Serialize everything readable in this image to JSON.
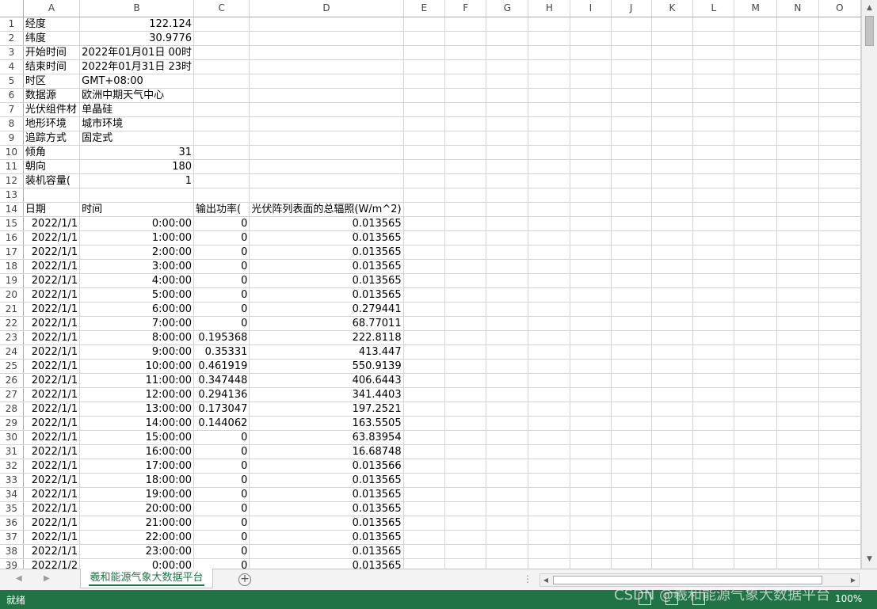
{
  "columns": [
    "A",
    "B",
    "C",
    "D",
    "E",
    "F",
    "G",
    "H",
    "I",
    "J",
    "K",
    "L",
    "M",
    "N",
    "O"
  ],
  "rows": [
    {
      "n": "1",
      "a": "经度",
      "b": "122.124",
      "c": "",
      "d": ""
    },
    {
      "n": "2",
      "a": "纬度",
      "b": "30.9776",
      "c": "",
      "d": ""
    },
    {
      "n": "3",
      "a": "开始时间",
      "b": "2022年01月01日 00时",
      "c": "",
      "d": ""
    },
    {
      "n": "4",
      "a": "结束时间",
      "b": "2022年01月31日 23时",
      "c": "",
      "d": ""
    },
    {
      "n": "5",
      "a": "时区",
      "b": "GMT+08:00",
      "c": "",
      "d": ""
    },
    {
      "n": "6",
      "a": "数据源",
      "b": "欧洲中期天气中心",
      "c": "",
      "d": ""
    },
    {
      "n": "7",
      "a": "光伏组件材",
      "b": "单晶硅",
      "c": "",
      "d": ""
    },
    {
      "n": "8",
      "a": "地形环境",
      "b": "城市环境",
      "c": "",
      "d": ""
    },
    {
      "n": "9",
      "a": "追踪方式",
      "b": "固定式",
      "c": "",
      "d": ""
    },
    {
      "n": "10",
      "a": "倾角",
      "b": "31",
      "c": "",
      "d": ""
    },
    {
      "n": "11",
      "a": "朝向",
      "b": "180",
      "c": "",
      "d": ""
    },
    {
      "n": "12",
      "a": "装机容量(",
      "b": "1",
      "c": "",
      "d": ""
    },
    {
      "n": "13",
      "a": "",
      "b": "",
      "c": "",
      "d": ""
    },
    {
      "n": "14",
      "a": "日期",
      "b": "时间",
      "c": "输出功率(",
      "d": "光伏阵列表面的总辐照(W/m^2)"
    },
    {
      "n": "15",
      "a": "2022/1/1",
      "b": "0:00:00",
      "c": "0",
      "d": "0.013565"
    },
    {
      "n": "16",
      "a": "2022/1/1",
      "b": "1:00:00",
      "c": "0",
      "d": "0.013565"
    },
    {
      "n": "17",
      "a": "2022/1/1",
      "b": "2:00:00",
      "c": "0",
      "d": "0.013565"
    },
    {
      "n": "18",
      "a": "2022/1/1",
      "b": "3:00:00",
      "c": "0",
      "d": "0.013565"
    },
    {
      "n": "19",
      "a": "2022/1/1",
      "b": "4:00:00",
      "c": "0",
      "d": "0.013565"
    },
    {
      "n": "20",
      "a": "2022/1/1",
      "b": "5:00:00",
      "c": "0",
      "d": "0.013565"
    },
    {
      "n": "21",
      "a": "2022/1/1",
      "b": "6:00:00",
      "c": "0",
      "d": "0.279441"
    },
    {
      "n": "22",
      "a": "2022/1/1",
      "b": "7:00:00",
      "c": "0",
      "d": "68.77011"
    },
    {
      "n": "23",
      "a": "2022/1/1",
      "b": "8:00:00",
      "c": "0.195368",
      "d": "222.8118"
    },
    {
      "n": "24",
      "a": "2022/1/1",
      "b": "9:00:00",
      "c": "0.35331",
      "d": "413.447"
    },
    {
      "n": "25",
      "a": "2022/1/1",
      "b": "10:00:00",
      "c": "0.461919",
      "d": "550.9139"
    },
    {
      "n": "26",
      "a": "2022/1/1",
      "b": "11:00:00",
      "c": "0.347448",
      "d": "406.6443"
    },
    {
      "n": "27",
      "a": "2022/1/1",
      "b": "12:00:00",
      "c": "0.294136",
      "d": "341.4403"
    },
    {
      "n": "28",
      "a": "2022/1/1",
      "b": "13:00:00",
      "c": "0.173047",
      "d": "197.2521"
    },
    {
      "n": "29",
      "a": "2022/1/1",
      "b": "14:00:00",
      "c": "0.144062",
      "d": "163.5505"
    },
    {
      "n": "30",
      "a": "2022/1/1",
      "b": "15:00:00",
      "c": "0",
      "d": "63.83954"
    },
    {
      "n": "31",
      "a": "2022/1/1",
      "b": "16:00:00",
      "c": "0",
      "d": "16.68748"
    },
    {
      "n": "32",
      "a": "2022/1/1",
      "b": "17:00:00",
      "c": "0",
      "d": "0.013566"
    },
    {
      "n": "33",
      "a": "2022/1/1",
      "b": "18:00:00",
      "c": "0",
      "d": "0.013565"
    },
    {
      "n": "34",
      "a": "2022/1/1",
      "b": "19:00:00",
      "c": "0",
      "d": "0.013565"
    },
    {
      "n": "35",
      "a": "2022/1/1",
      "b": "20:00:00",
      "c": "0",
      "d": "0.013565"
    },
    {
      "n": "36",
      "a": "2022/1/1",
      "b": "21:00:00",
      "c": "0",
      "d": "0.013565"
    },
    {
      "n": "37",
      "a": "2022/1/1",
      "b": "22:00:00",
      "c": "0",
      "d": "0.013565"
    },
    {
      "n": "38",
      "a": "2022/1/1",
      "b": "23:00:00",
      "c": "0",
      "d": "0.013565"
    },
    {
      "n": "39",
      "a": "2022/1/2",
      "b": "0:00:00",
      "c": "0",
      "d": "0.013565"
    }
  ],
  "tabbar": {
    "sheet_name": "羲和能源气象大数据平台",
    "add_symbol": "+"
  },
  "statusbar": {
    "status": "就绪",
    "zoom": "100%",
    "watermark": "CSDN @羲和能源气象大数据平台",
    "accent": "#217346"
  },
  "icons": {
    "scroll_up": "triangle-up-icon",
    "scroll_down": "triangle-down-icon",
    "scroll_left": "triangle-left-icon",
    "scroll_right": "triangle-right-icon",
    "add_sheet": "plus-circle-icon"
  }
}
